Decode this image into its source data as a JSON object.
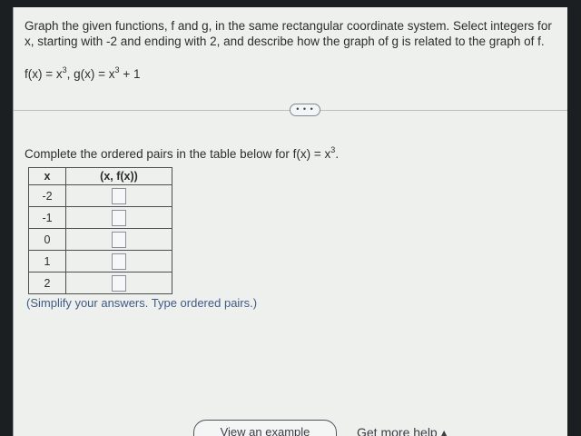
{
  "question": {
    "text": "Graph the given functions, f and g, in the same rectangular coordinate system. Select integers for x, starting with -2 and ending with 2, and describe how the graph of g is related to the graph of f.",
    "f_lhs": "f(x) = x",
    "f_exp": "3",
    "g_lhs": ", g(x) = x",
    "g_exp": "3",
    "g_rest": " + 1"
  },
  "expand_button": {
    "label": "• • •"
  },
  "instruction": {
    "text": "Complete the ordered pairs in the table below for f(x) = x",
    "exp": "3",
    "tail": "."
  },
  "table": {
    "headers": [
      "x",
      "(x, f(x))"
    ],
    "x_values": [
      "-2",
      "-1",
      "0",
      "1",
      "2"
    ]
  },
  "hint": "(Simplify your answers. Type ordered pairs.)",
  "bottom": {
    "example_button": "View an example",
    "help_link": "Get more help ▴"
  }
}
